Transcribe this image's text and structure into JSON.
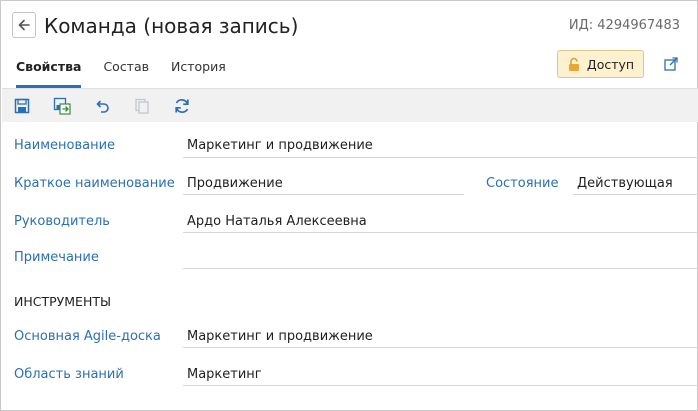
{
  "header": {
    "title": "Команда (новая запись)",
    "record_id": "ИД: 4294967483",
    "back_icon": "arrow-left-icon"
  },
  "tabs": [
    {
      "label": "Свойства",
      "active": true
    },
    {
      "label": "Состав",
      "active": false
    },
    {
      "label": "История",
      "active": false
    }
  ],
  "access_button": {
    "label": "Доступ",
    "icon": "lock-icon",
    "color": "#fdf1cf"
  },
  "toolbar": {
    "buttons": [
      {
        "icon": "save-icon",
        "enabled": true
      },
      {
        "icon": "save-and-close-icon",
        "enabled": true
      },
      {
        "icon": "undo-icon",
        "enabled": true
      },
      {
        "icon": "copy-icon",
        "enabled": false
      },
      {
        "icon": "refresh-icon",
        "enabled": true
      }
    ]
  },
  "fields": {
    "name": {
      "label": "Наименование",
      "value": "Маркетинг и продвижение"
    },
    "short_name": {
      "label": "Краткое наименование",
      "value": "Продвижение"
    },
    "state": {
      "label": "Состояние",
      "value": "Действующая"
    },
    "head": {
      "label": "Руководитель",
      "value": "Ардо Наталья Алексеевна"
    },
    "note": {
      "label": "Примечание",
      "value": ""
    }
  },
  "tools_section": {
    "title": "ИНСТРУМЕНТЫ",
    "agile_board": {
      "label": "Основная Agile-доска",
      "value": "Маркетинг и продвижение"
    },
    "knowledge_area": {
      "label": "Область знаний",
      "value": "Маркетинг"
    }
  },
  "colors": {
    "accent": "#2a6fb5",
    "toolbar_bg": "#f1f1f1"
  }
}
